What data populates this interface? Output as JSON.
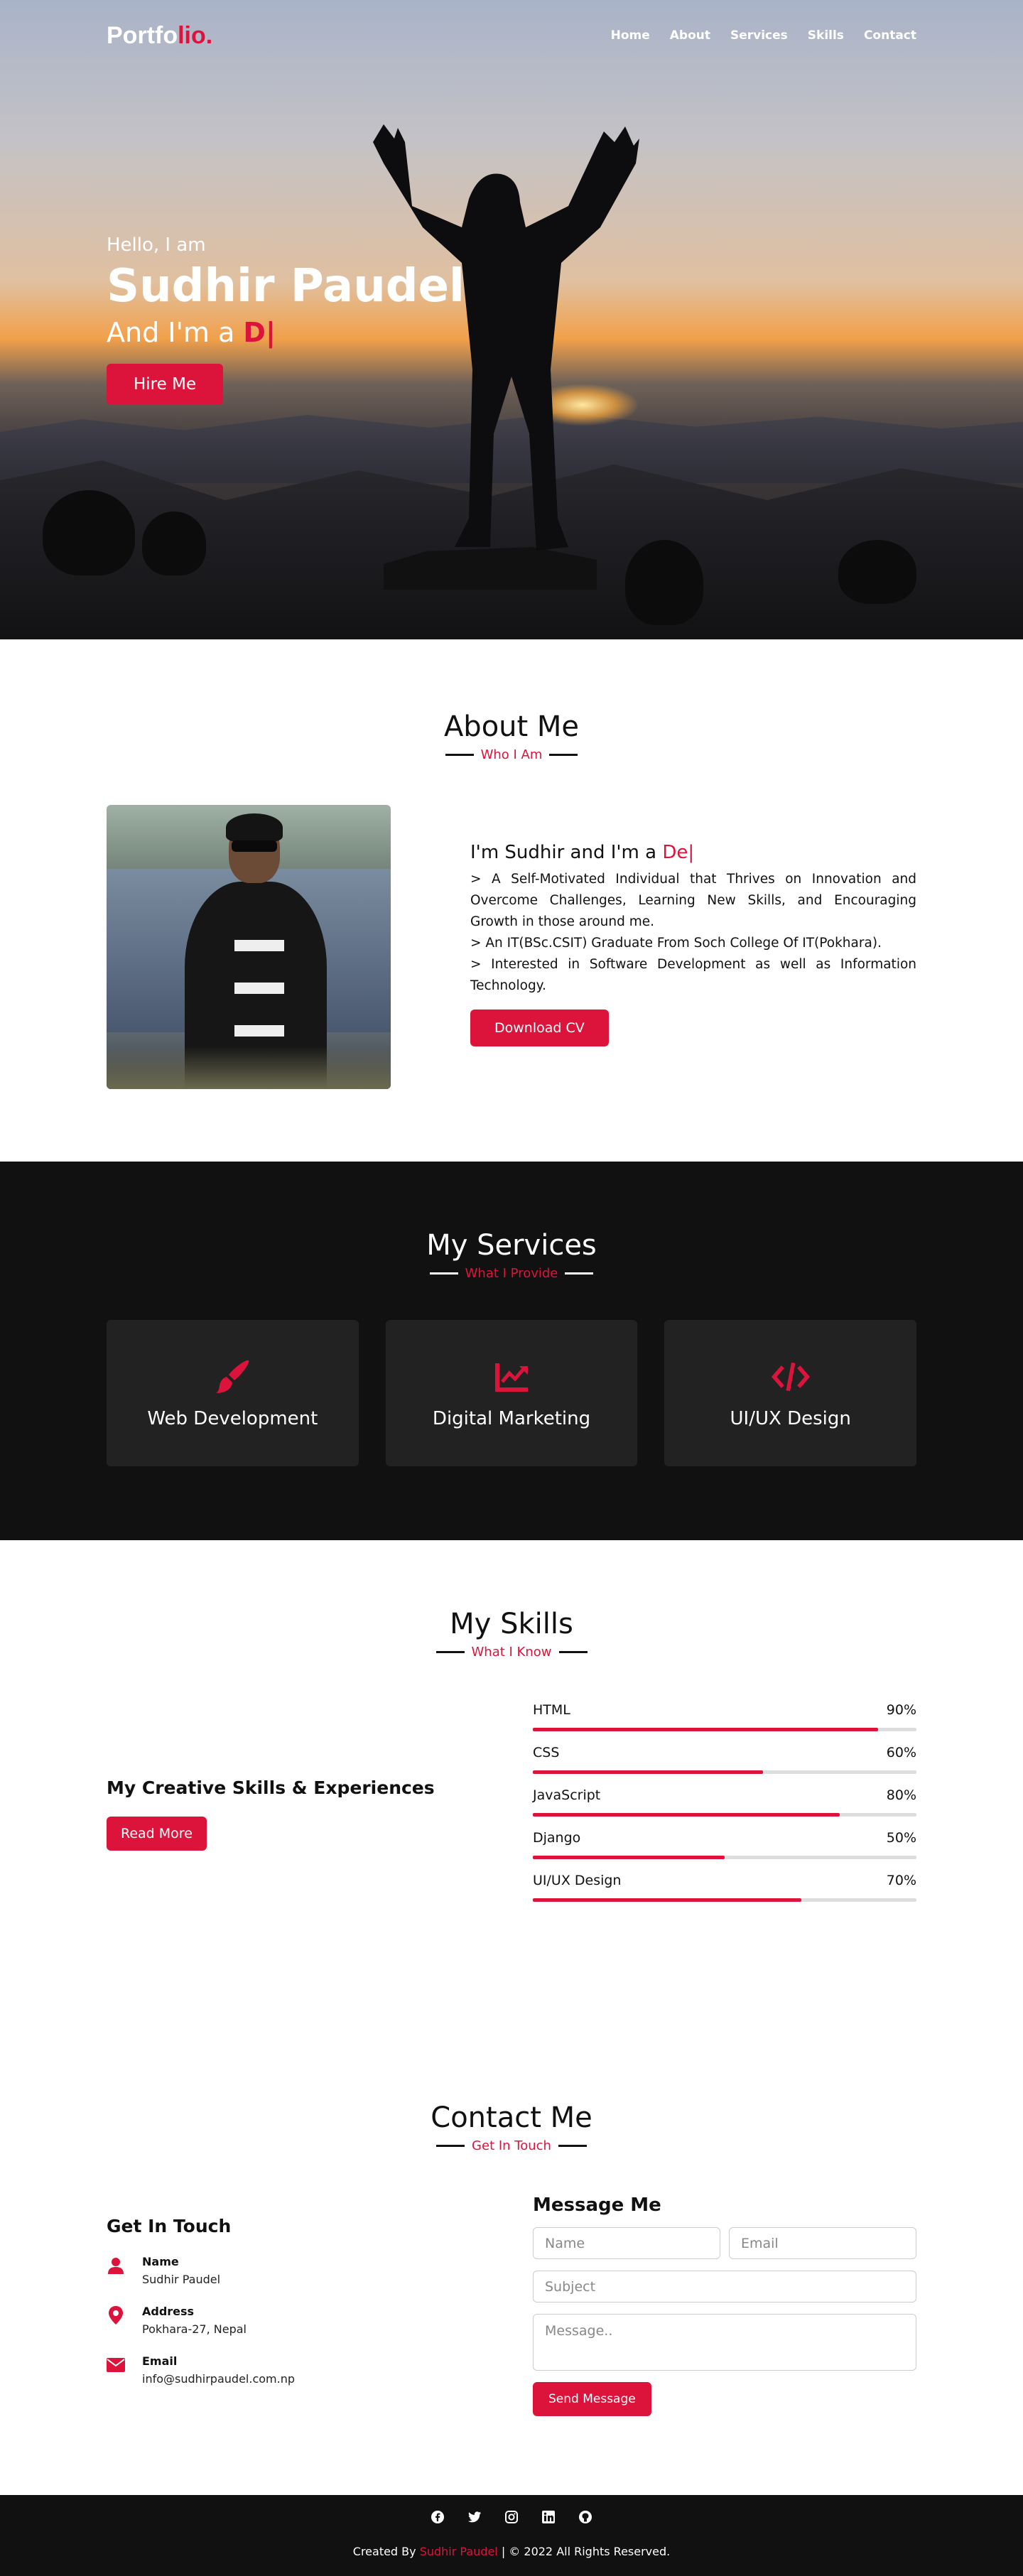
{
  "nav": {
    "logo_main": "Portfo",
    "logo_accent": "lio.",
    "links": [
      "Home",
      "About",
      "Services",
      "Skills",
      "Contact"
    ]
  },
  "hero": {
    "greeting": "Hello, I am",
    "name": "Sudhir Paudel",
    "role_prefix": "And I'm a ",
    "role_typed": "D|",
    "button": "Hire Me"
  },
  "about": {
    "title": "About Me",
    "subtitle": "Who I Am",
    "heading_prefix": "I'm Sudhir and I'm a ",
    "heading_typed": "De|",
    "paragraphs": [
      "> A Self-Motivated Individual that Thrives on Innovation and Overcome Challenges, Learning New Skills, and Encouraging Growth in those around me.",
      "> An IT(BSc.CSIT) Graduate From Soch College Of IT(Pokhara).",
      "> Interested in Software Development as well as Information Technology."
    ],
    "button": "Download CV"
  },
  "services": {
    "title": "My Services",
    "subtitle": "What I Provide",
    "cards": [
      {
        "title": "Web Development",
        "icon": "paint-brush-icon"
      },
      {
        "title": "Digital Marketing",
        "icon": "chart-line-icon"
      },
      {
        "title": "UI/UX Design",
        "icon": "code-icon"
      }
    ]
  },
  "skills": {
    "title": "My Skills",
    "subtitle": "What I Know",
    "heading": "My Creative Skills & Experiences",
    "button": "Read More",
    "items": [
      {
        "name": "HTML",
        "percent": "90%",
        "value": 90
      },
      {
        "name": "CSS",
        "percent": "60%",
        "value": 60
      },
      {
        "name": "JavaScript",
        "percent": "80%",
        "value": 80
      },
      {
        "name": "Django",
        "percent": "50%",
        "value": 50
      },
      {
        "name": "UI/UX Design",
        "percent": "70%",
        "value": 70
      }
    ]
  },
  "contact": {
    "title": "Contact Me",
    "subtitle": "Get In Touch",
    "left_heading": "Get In Touch",
    "info": [
      {
        "label": "Name",
        "value": "Sudhir Paudel"
      },
      {
        "label": "Address",
        "value": "Pokhara-27, Nepal"
      },
      {
        "label": "Email",
        "value": "info@sudhirpaudel.com.np"
      }
    ],
    "form_heading": "Message Me",
    "placeholders": {
      "name": "Name",
      "email": "Email",
      "subject": "Subject",
      "message": "Message.."
    },
    "button": "Send Message"
  },
  "footer": {
    "social_icons": [
      "facebook-icon",
      "twitter-icon",
      "instagram-icon",
      "linkedin-icon",
      "github-icon"
    ],
    "created_by": "Created By ",
    "author": "Sudhir Paudel",
    "rights": " | © 2022 All Rights Reserved."
  },
  "colors": {
    "accent": "#dc143c",
    "dark": "#111111",
    "card": "#222222"
  }
}
